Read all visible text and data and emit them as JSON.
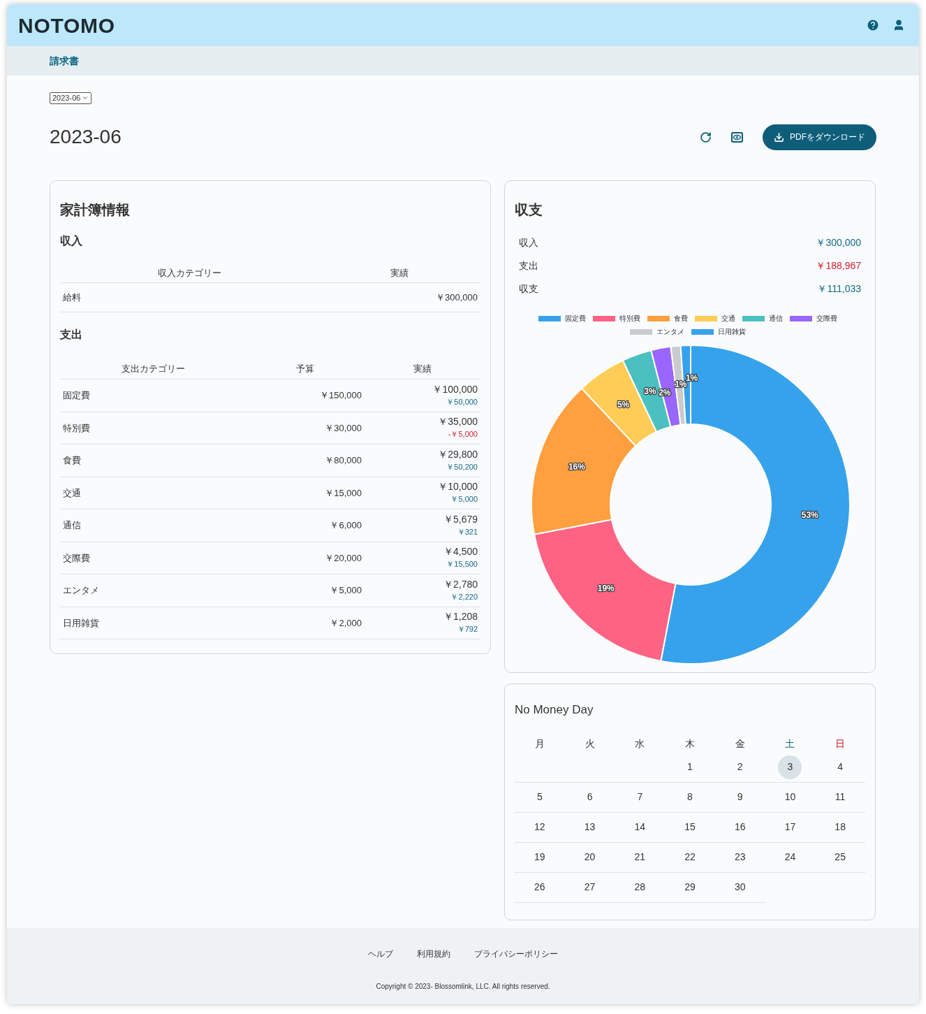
{
  "header": {
    "logo": "NOTOMO"
  },
  "breadcrumb": {
    "label": "請求書"
  },
  "month_select": {
    "value": "2023-06"
  },
  "page_title": "2023-06",
  "download_button": {
    "label": "PDFをダウンロード"
  },
  "household_card": {
    "title": "家計簿情報",
    "income": {
      "heading": "収入",
      "columns": [
        "収入カテゴリー",
        "実績"
      ],
      "rows": [
        {
          "category": "給料",
          "actual": "￥300,000"
        }
      ]
    },
    "expense": {
      "heading": "支出",
      "columns": [
        "支出カテゴリー",
        "予算",
        "実績"
      ],
      "rows": [
        {
          "category": "固定費",
          "budget": "￥150,000",
          "actual": "￥100,000",
          "difference": "￥50,000",
          "over_budget": false
        },
        {
          "category": "特別費",
          "budget": "￥30,000",
          "actual": "￥35,000",
          "difference": "-￥5,000",
          "over_budget": true
        },
        {
          "category": "食費",
          "budget": "￥80,000",
          "actual": "￥29,800",
          "difference": "￥50,200",
          "over_budget": false
        },
        {
          "category": "交通",
          "budget": "￥15,000",
          "actual": "￥10,000",
          "difference": "￥5,000",
          "over_budget": false
        },
        {
          "category": "通信",
          "budget": "￥6,000",
          "actual": "￥5,679",
          "difference": "￥321",
          "over_budget": false
        },
        {
          "category": "交際費",
          "budget": "￥20,000",
          "actual": "￥4,500",
          "difference": "￥15,500",
          "over_budget": false
        },
        {
          "category": "エンタメ",
          "budget": "￥5,000",
          "actual": "￥2,780",
          "difference": "￥2,220",
          "over_budget": false
        },
        {
          "category": "日用雑貨",
          "budget": "￥2,000",
          "actual": "￥1,208",
          "difference": "￥792",
          "over_budget": false
        }
      ]
    }
  },
  "balance_card": {
    "title": "収支",
    "summary": [
      {
        "label": "収入",
        "amount": "￥300,000",
        "negative": false
      },
      {
        "label": "支出",
        "amount": "￥188,967",
        "negative": true
      },
      {
        "label": "収支",
        "amount": "￥111,033",
        "negative": false
      }
    ],
    "chart_data": {
      "type": "donut",
      "categories": [
        "固定費",
        "特別費",
        "食費",
        "交通",
        "通信",
        "交際費",
        "エンタメ",
        "日用雑貨"
      ],
      "values": [
        53,
        19,
        16,
        5,
        3,
        2,
        1,
        1
      ],
      "legend": "top",
      "colors": [
        "#36a2eb",
        "#ff6384",
        "#ff9f40",
        "#ffcd56",
        "#4bc0c0",
        "#9966ff",
        "#c9cbcf",
        "#36a2eb"
      ],
      "value_labels": [
        "53%",
        "19%",
        "16%",
        "5%",
        "3%",
        "2%",
        "1%",
        "1%"
      ]
    }
  },
  "calendar_card": {
    "title": "No Money Day",
    "weekdays": [
      {
        "label": "月",
        "kind": "weekday"
      },
      {
        "label": "火",
        "kind": "weekday"
      },
      {
        "label": "水",
        "kind": "weekday"
      },
      {
        "label": "木",
        "kind": "weekday"
      },
      {
        "label": "金",
        "kind": "weekday"
      },
      {
        "label": "土",
        "kind": "saturday"
      },
      {
        "label": "日",
        "kind": "sunday"
      }
    ],
    "weeks": [
      [
        {
          "day": "1",
          "selected": false
        },
        {
          "day": "2",
          "selected": false
        },
        {
          "day": "3",
          "selected": true
        },
        {
          "day": "4",
          "selected": false
        }
      ],
      [
        {
          "day": "5",
          "selected": false
        },
        {
          "day": "6",
          "selected": false
        },
        {
          "day": "7",
          "selected": false
        },
        {
          "day": "8",
          "selected": false
        },
        {
          "day": "9",
          "selected": false
        },
        {
          "day": "10",
          "selected": false
        },
        {
          "day": "11",
          "selected": false
        }
      ],
      [
        {
          "day": "12",
          "selected": false
        },
        {
          "day": "13",
          "selected": false
        },
        {
          "day": "14",
          "selected": false
        },
        {
          "day": "15",
          "selected": false
        },
        {
          "day": "16",
          "selected": false
        },
        {
          "day": "17",
          "selected": false
        },
        {
          "day": "18",
          "selected": false
        }
      ],
      [
        {
          "day": "19",
          "selected": false
        },
        {
          "day": "20",
          "selected": false
        },
        {
          "day": "21",
          "selected": false
        },
        {
          "day": "22",
          "selected": false
        },
        {
          "day": "23",
          "selected": false
        },
        {
          "day": "24",
          "selected": false
        },
        {
          "day": "25",
          "selected": false
        }
      ],
      [
        {
          "day": "26",
          "selected": false
        },
        {
          "day": "27",
          "selected": false
        },
        {
          "day": "28",
          "selected": false
        },
        {
          "day": "29",
          "selected": false
        },
        {
          "day": "30",
          "selected": false
        }
      ]
    ]
  },
  "footer": {
    "links": [
      "ヘルプ",
      "利用規約",
      "プライバシーポリシー"
    ],
    "copyright": "Copyright © 2023- Blossomlink, LLC. All rights reserved."
  }
}
